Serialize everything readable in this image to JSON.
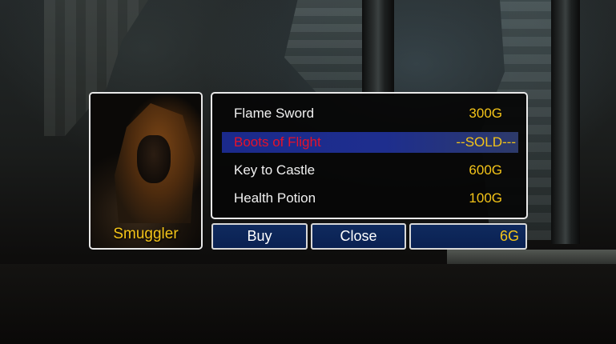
{
  "merchant": {
    "name": "Smuggler"
  },
  "shop": {
    "items": [
      {
        "name": "Flame Sword",
        "price": "300G",
        "sold": false
      },
      {
        "name": "Boots of Flight",
        "price": "--SOLD---",
        "sold": true
      },
      {
        "name": "Key to Castle",
        "price": "600G",
        "sold": false
      },
      {
        "name": "Health Potion",
        "price": "100G",
        "sold": false
      }
    ]
  },
  "actions": {
    "buy_label": "Buy",
    "close_label": "Close"
  },
  "player": {
    "gold": "6G"
  },
  "colors": {
    "accent_gold": "#f4c418",
    "sold_text": "#e6122a",
    "selection_bar": "#1b2a8c",
    "button_fill": "#0f2a5e",
    "panel_border": "#e9e9e9"
  }
}
